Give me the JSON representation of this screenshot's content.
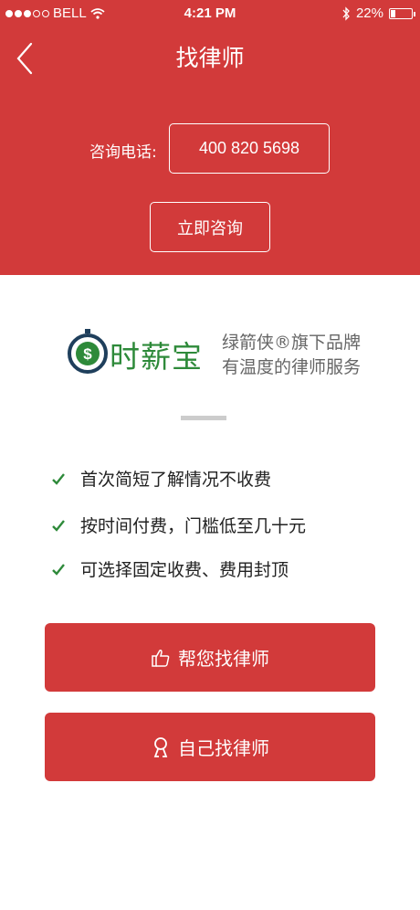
{
  "status_bar": {
    "carrier": "BELL",
    "time": "4:21 PM",
    "battery_text": "22%",
    "battery_level": 0.22
  },
  "header": {
    "title": "找律师",
    "phone_label": "咨询电话:",
    "phone_number": "400 820 5698",
    "consult_button": "立即咨询",
    "background_color": "#d23a3a"
  },
  "brand": {
    "name": "时薪宝",
    "slogan_line1": "绿箭侠®旗下品牌",
    "slogan_line2": "有温度的律师服务",
    "brand_color": "#2e8a3a"
  },
  "features": [
    {
      "icon": "check-icon",
      "text": "首次简短了解情况不收费"
    },
    {
      "icon": "check-icon",
      "text": "按时间付费，门槛低至几十元"
    },
    {
      "icon": "check-icon",
      "text": "可选择固定收费、费用封顶"
    }
  ],
  "actions": {
    "help_find": {
      "icon": "thumbs-up-icon",
      "label": "帮您找律师"
    },
    "self_find": {
      "icon": "person-icon",
      "label": "自己找律师"
    }
  }
}
